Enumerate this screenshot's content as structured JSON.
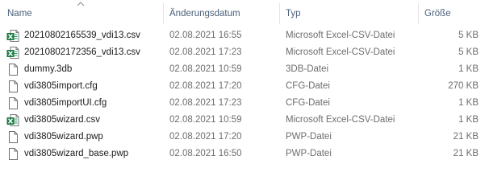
{
  "columns": {
    "name": "Name",
    "date": "Änderungsdatum",
    "type": "Typ",
    "size": "Größe"
  },
  "files": [
    {
      "icon": "excel-csv-icon",
      "name": "20210802165539_vdi13.csv",
      "date": "02.08.2021 16:55",
      "type": "Microsoft Excel-CSV-Datei",
      "size": "5 KB"
    },
    {
      "icon": "excel-csv-icon",
      "name": "20210802172356_vdi13.csv",
      "date": "02.08.2021 17:23",
      "type": "Microsoft Excel-CSV-Datei",
      "size": "5 KB"
    },
    {
      "icon": "generic-file-icon",
      "name": "dummy.3db",
      "date": "02.08.2021 10:59",
      "type": "3DB-Datei",
      "size": "1 KB"
    },
    {
      "icon": "generic-file-icon",
      "name": "vdi3805import.cfg",
      "date": "02.08.2021 17:20",
      "type": "CFG-Datei",
      "size": "270 KB"
    },
    {
      "icon": "generic-file-icon",
      "name": "vdi3805importUI.cfg",
      "date": "02.08.2021 17:23",
      "type": "CFG-Datei",
      "size": "1 KB"
    },
    {
      "icon": "excel-csv-icon",
      "name": "vdi3805wizard.csv",
      "date": "02.08.2021 10:59",
      "type": "Microsoft Excel-CSV-Datei",
      "size": "1 KB"
    },
    {
      "icon": "generic-file-icon",
      "name": "vdi3805wizard.pwp",
      "date": "02.08.2021 17:20",
      "type": "PWP-Datei",
      "size": "21 KB"
    },
    {
      "icon": "generic-file-icon",
      "name": "vdi3805wizard_base.pwp",
      "date": "02.08.2021 16:50",
      "type": "PWP-Datei",
      "size": "21 KB"
    }
  ],
  "colors": {
    "header_text": "#4c607a",
    "excel_green": "#1d7a43"
  }
}
